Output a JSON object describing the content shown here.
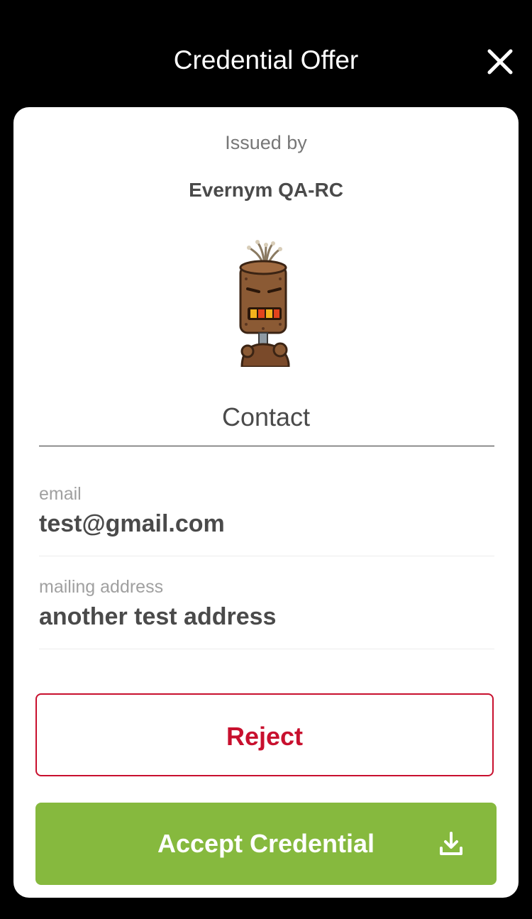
{
  "header": {
    "title": "Credential Offer",
    "close_icon": "close-icon"
  },
  "issuer": {
    "issued_by_label": "Issued by",
    "name": "Evernym QA-RC",
    "avatar_icon": "robot-avatar"
  },
  "credential": {
    "name": "Contact",
    "attributes": [
      {
        "label": "email",
        "value": "test@gmail.com"
      },
      {
        "label": "mailing address",
        "value": "another test address"
      }
    ]
  },
  "actions": {
    "reject_label": "Reject",
    "accept_label": "Accept Credential",
    "accept_icon": "download-icon"
  },
  "colors": {
    "background": "#000000",
    "card": "#ffffff",
    "reject": "#c8102e",
    "accept": "#86b93e"
  }
}
